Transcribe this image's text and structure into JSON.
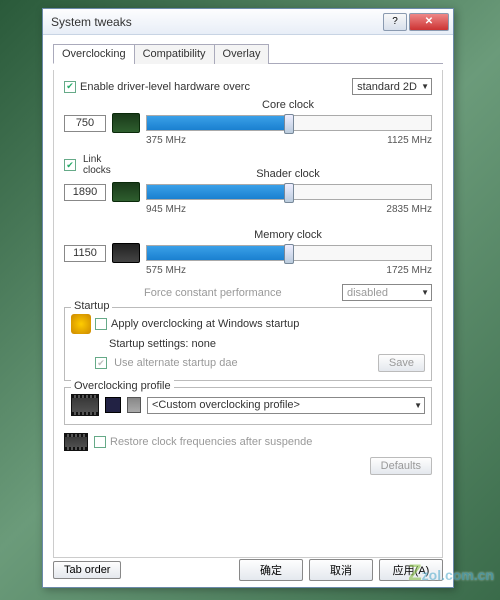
{
  "window": {
    "title": "System tweaks"
  },
  "tabs": [
    "Overclocking",
    "Compatibility",
    "Overlay"
  ],
  "enable": {
    "label": "Enable driver-level hardware overc",
    "checked": true
  },
  "profile_select": "standard 2D",
  "core": {
    "label": "Core clock",
    "value": "750",
    "min": "375 MHz",
    "max": "1125 MHz",
    "pct": 50
  },
  "link": {
    "label": "Link\nclocks",
    "checked": true
  },
  "shader": {
    "label": "Shader clock",
    "value": "1890",
    "min": "945 MHz",
    "max": "2835 MHz",
    "pct": 50
  },
  "memory": {
    "label": "Memory clock",
    "value": "1150",
    "min": "575 MHz",
    "max": "1725 MHz",
    "pct": 50
  },
  "force": {
    "label": "Force constant performance",
    "value": "disabled"
  },
  "startup": {
    "title": "Startup",
    "apply": "Apply overclocking at Windows startup",
    "settings": "Startup settings: none",
    "alt": "Use alternate startup dae",
    "save": "Save"
  },
  "oc_profile": {
    "title": "Overclocking profile",
    "value": "<Custom overclocking profile>"
  },
  "restore": "Restore clock frequencies after suspende",
  "defaults": "Defaults",
  "footer": {
    "taborder": "Tab order",
    "ok": "确定",
    "cancel": "取消",
    "apply": "应用(A)"
  },
  "watermark": "zol.com.cn"
}
